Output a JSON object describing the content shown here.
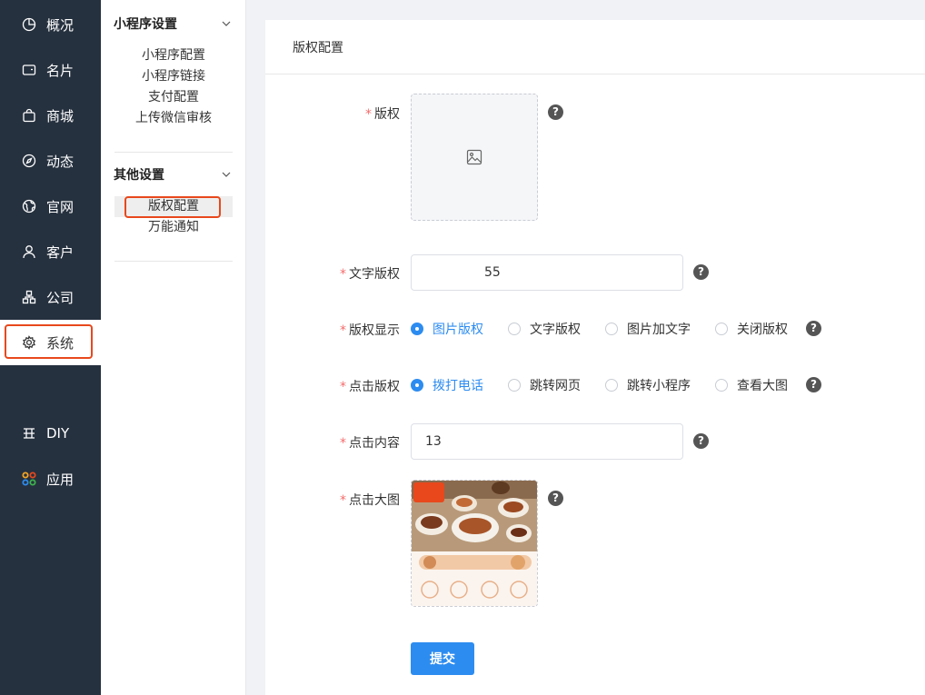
{
  "sidebar": {
    "items": [
      {
        "label": "概况",
        "icon": "pie-chart-icon"
      },
      {
        "label": "名片",
        "icon": "card-icon"
      },
      {
        "label": "商城",
        "icon": "bag-icon"
      },
      {
        "label": "动态",
        "icon": "compass-icon"
      },
      {
        "label": "官网",
        "icon": "globe-icon"
      },
      {
        "label": "客户",
        "icon": "user-icon"
      },
      {
        "label": "公司",
        "icon": "company-icon"
      },
      {
        "label": "系统",
        "icon": "gear-icon",
        "active": true
      }
    ],
    "extra": [
      {
        "label": "DIY",
        "icon": "diy-icon"
      },
      {
        "label": "应用",
        "icon": "apps-icon"
      }
    ]
  },
  "subnav": {
    "groups": [
      {
        "title": "小程序设置",
        "items": [
          "小程序配置",
          "小程序链接",
          "支付配置",
          "上传微信审核"
        ]
      },
      {
        "title": "其他设置",
        "items": [
          "版权配置",
          "万能通知"
        ],
        "active": "版权配置"
      }
    ]
  },
  "page": {
    "title": "版权配置",
    "form": {
      "copyright_image_label": "版权",
      "text_copyright_label": "文字版权",
      "text_copyright_value": "55",
      "display_label": "版权显示",
      "display_options": [
        "图片版权",
        "文字版权",
        "图片加文字",
        "关闭版权"
      ],
      "display_selected": "图片版权",
      "click_label": "点击版权",
      "click_options": [
        "拨打电话",
        "跳转网页",
        "跳转小程序",
        "查看大图"
      ],
      "click_selected": "拨打电话",
      "click_content_label": "点击内容",
      "click_content_value": "13",
      "big_image_label": "点击大图",
      "help_glyph": "?",
      "required_mark": "*",
      "submit_label": "提交"
    }
  },
  "colors": {
    "sidebar_bg": "#26313f",
    "accent": "#2d8cf0",
    "highlight_box": "#e8481c",
    "required": "#f56c6c"
  }
}
